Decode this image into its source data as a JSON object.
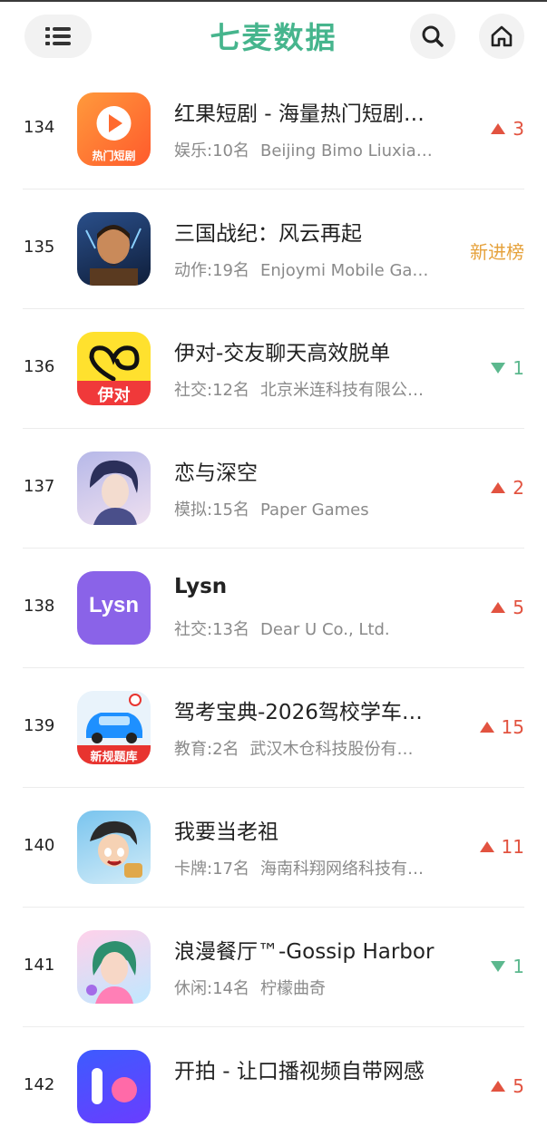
{
  "header": {
    "brand": "七麦数据"
  },
  "colors": {
    "brand_green": "#46b58d",
    "up_red": "#e25340",
    "down_green": "#5cb88e",
    "new_orange": "#e6a23c"
  },
  "rows": [
    {
      "rank": "134",
      "title": "红果短剧 - 海量热门短剧…",
      "category": "娱乐:10名",
      "developer": "Beijing Bimo Liuxia…",
      "change": "3",
      "direction": "up",
      "icon": "hongguo-play-icon",
      "icon_text": "热门短剧"
    },
    {
      "rank": "135",
      "title": "三国战纪：风云再起",
      "category": "动作:19名",
      "developer": "Enjoymi Mobile Ga…",
      "change": "新进榜",
      "direction": "new",
      "icon": "warrior-portrait-icon",
      "icon_text": ""
    },
    {
      "rank": "136",
      "title": "伊对-交友聊天高效脱单",
      "category": "社交:12名",
      "developer": "北京米连科技有限公…",
      "change": "1",
      "direction": "down",
      "icon": "yidui-heart-icon",
      "icon_text": "伊对"
    },
    {
      "rank": "137",
      "title": "恋与深空",
      "category": "模拟:15名",
      "developer": "Paper Games",
      "change": "2",
      "direction": "up",
      "icon": "character-portrait-icon",
      "icon_text": ""
    },
    {
      "rank": "138",
      "title": "Lysn",
      "category": "社交:13名",
      "developer": "Dear U Co., Ltd.",
      "change": "5",
      "direction": "up",
      "icon": "lysn-logo-icon",
      "icon_text": "Lysn"
    },
    {
      "rank": "139",
      "title": "驾考宝典-2026驾校学车…",
      "category": "教育:2名",
      "developer": "武汉木仓科技股份有…",
      "change": "15",
      "direction": "up",
      "icon": "car-icon",
      "icon_text": "新规题库"
    },
    {
      "rank": "140",
      "title": "我要当老祖",
      "category": "卡牌:17名",
      "developer": "海南科翔网络科技有…",
      "change": "11",
      "direction": "up",
      "icon": "cartoon-character-icon",
      "icon_text": ""
    },
    {
      "rank": "141",
      "title": "浪漫餐厅™-Gossip Harbor",
      "category": "休闲:14名",
      "developer": "柠檬曲奇",
      "change": "1",
      "direction": "down",
      "icon": "girl-portrait-icon",
      "icon_text": ""
    },
    {
      "rank": "142",
      "title": "开拍 - 让口播视频自带网感",
      "category": "",
      "developer": "",
      "change": "5",
      "direction": "up",
      "icon": "kaipai-logo-icon",
      "icon_text": ""
    }
  ]
}
